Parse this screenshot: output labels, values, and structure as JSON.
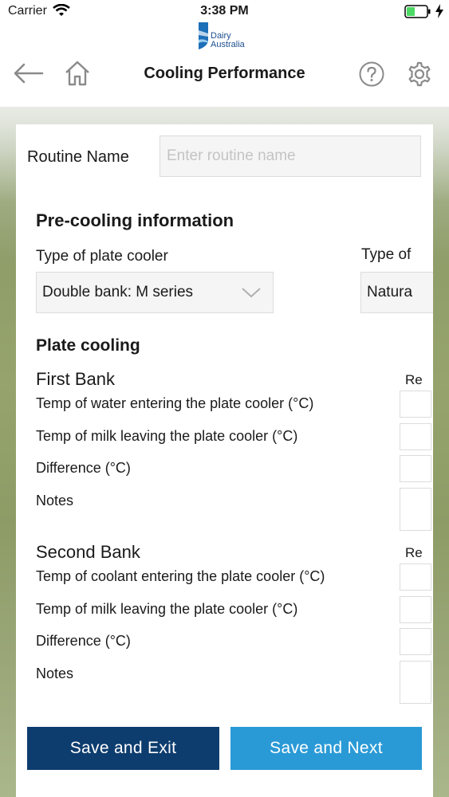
{
  "status_bar": {
    "carrier": "Carrier",
    "time": "3:38 PM",
    "icons": [
      "wifi-icon",
      "battery-icon",
      "charging-bolt-icon"
    ]
  },
  "logo": {
    "line1": "Dairy",
    "line2": "Australia"
  },
  "header": {
    "title": "Cooling Performance",
    "icons": [
      "back-arrow-icon",
      "home-icon",
      "help-icon",
      "settings-gear-icon"
    ]
  },
  "routine": {
    "label": "Routine Name",
    "placeholder": "Enter routine name"
  },
  "precooling": {
    "title": "Pre-cooling information",
    "plate_cooler_type_label": "Type of plate cooler",
    "plate_cooler_type_value": "Double bank: M series",
    "second_type_label": "Type of",
    "second_type_value": "Natura"
  },
  "plate_cooling": {
    "title": "Plate cooling",
    "first_bank": {
      "title": "First Bank",
      "column_header": "Re",
      "rows": [
        "Temp of water entering the plate cooler (°C)",
        "Temp of milk leaving the plate cooler (°C)",
        "Difference (°C)",
        "Notes"
      ]
    },
    "second_bank": {
      "title": "Second Bank",
      "column_header": "Re",
      "rows": [
        "Temp of coolant entering the plate cooler (°C)",
        "Temp of milk leaving the plate cooler (°C)",
        "Difference (°C)",
        "Notes"
      ]
    }
  },
  "buttons": {
    "save_exit": "Save and Exit",
    "save_next": "Save and Next"
  },
  "colors": {
    "save_exit_bg": "#0d3c6e",
    "save_next_bg": "#2a9ad6",
    "logo_blue": "#1d4f8e"
  }
}
